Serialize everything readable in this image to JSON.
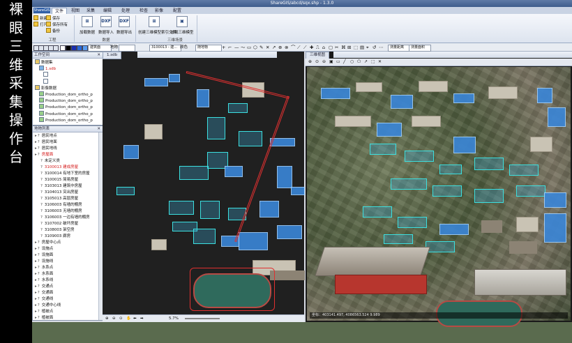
{
  "side_caption": [
    "裸",
    "眼",
    "三",
    "维",
    "采",
    "集",
    "操",
    "作",
    "台"
  ],
  "app": {
    "title": "ShareGIS/abcd/sqx.shp - 1.3.0",
    "app_button": "ShareGIS",
    "tabs": [
      "文件",
      "视图",
      "采集",
      "编辑",
      "处理",
      "检查",
      "影像",
      "配置"
    ]
  },
  "ribbon": {
    "file_group": {
      "new": "新建",
      "open": "打开",
      "save": "保存",
      "save_as": "保存所有",
      "backup": "备份",
      "label": "工程"
    },
    "buttons": [
      {
        "icon": "⊞",
        "label": "加载数据"
      },
      {
        "icon": "DXF",
        "label": "数据导入"
      },
      {
        "icon": "DXF",
        "label": "数据导出"
      }
    ],
    "group_label_data": "数据",
    "model_buttons": [
      {
        "icon": "⊞",
        "label": "创建三维模型索引文件"
      },
      {
        "icon": "▣",
        "label": "加载三维模型"
      }
    ],
    "group_label_model": "三维场景"
  },
  "toolbar": {
    "layer_select": "建筑面",
    "layer_select_label": "地物",
    "code_select": "3100013 - 建...",
    "color_label": "颜色",
    "color_value": "随地物",
    "measure_label": "测量距离",
    "right_label": "测量面积",
    "scale_label": "比例尺"
  },
  "layer_tree": {
    "title": "工作空间",
    "items": [
      {
        "label": "数据集",
        "indent": 0,
        "type": "folder"
      },
      {
        "label": "1.sdb",
        "indent": 1,
        "type": "db",
        "red": true
      },
      {
        "label": "",
        "indent": 2,
        "type": "check"
      },
      {
        "label": "",
        "indent": 2,
        "type": "check"
      },
      {
        "label": "影像数据",
        "indent": 0,
        "type": "folder"
      },
      {
        "label": "Production_dom_ortho_p",
        "indent": 1,
        "type": "img"
      },
      {
        "label": "Production_dom_ortho_p",
        "indent": 1,
        "type": "img"
      },
      {
        "label": "Production_dom_ortho_p",
        "indent": 1,
        "type": "img"
      },
      {
        "label": "Production_dom_ortho_p",
        "indent": 1,
        "type": "img"
      },
      {
        "label": "Production_dom_ortho_p",
        "indent": 1,
        "type": "img"
      }
    ]
  },
  "feature_list": {
    "title": "地物列表",
    "items": [
      {
        "label": "居民地点",
        "indent": 0
      },
      {
        "label": "居民地面",
        "indent": 0
      },
      {
        "label": "居民地线",
        "indent": 0
      },
      {
        "label": "房屋面",
        "indent": 0,
        "red": true
      },
      {
        "label": "未定义类",
        "indent": 1
      },
      {
        "label": "3100013  建成房屋",
        "indent": 1,
        "red": true
      },
      {
        "label": "3100014  有地下室的房屋",
        "indent": 1
      },
      {
        "label": "3100015  简易房屋",
        "indent": 1
      },
      {
        "label": "3103013  建筑中房屋",
        "indent": 1
      },
      {
        "label": "3104013  突出房屋",
        "indent": 1
      },
      {
        "label": "3105013  高层房屋",
        "indent": 1
      },
      {
        "label": "3106003  有墙的棚房",
        "indent": 1
      },
      {
        "label": "3106003  无墙的棚房",
        "indent": 1
      },
      {
        "label": "3106003  一边有墙的棚房",
        "indent": 1
      },
      {
        "label": "3107002  破坏房屋",
        "indent": 1
      },
      {
        "label": "3108003  架空房",
        "indent": 1
      },
      {
        "label": "3109003  廊房",
        "indent": 1
      },
      {
        "label": "房屋中心点",
        "indent": 0
      },
      {
        "label": "设施点",
        "indent": 0
      },
      {
        "label": "设施面",
        "indent": 0
      },
      {
        "label": "设施线",
        "indent": 0
      },
      {
        "label": "水系点",
        "indent": 0
      },
      {
        "label": "水系面",
        "indent": 0
      },
      {
        "label": "水系线",
        "indent": 0
      },
      {
        "label": "交通点",
        "indent": 0
      },
      {
        "label": "交通面",
        "indent": 0
      },
      {
        "label": "交通线",
        "indent": 0
      },
      {
        "label": "交通中心线",
        "indent": 0
      },
      {
        "label": "植被点",
        "indent": 0
      },
      {
        "label": "植被面",
        "indent": 0
      }
    ]
  },
  "map2d": {
    "tab": "1.sdb",
    "zoom": "5.7%"
  },
  "map3d": {
    "tab": "三维视图",
    "status": "坐标：403141.497, 4086563.524          9.989"
  },
  "colors": {
    "accent": "#3a86d8",
    "highlight": "#d41818",
    "cyan": "#3ce0e0"
  }
}
